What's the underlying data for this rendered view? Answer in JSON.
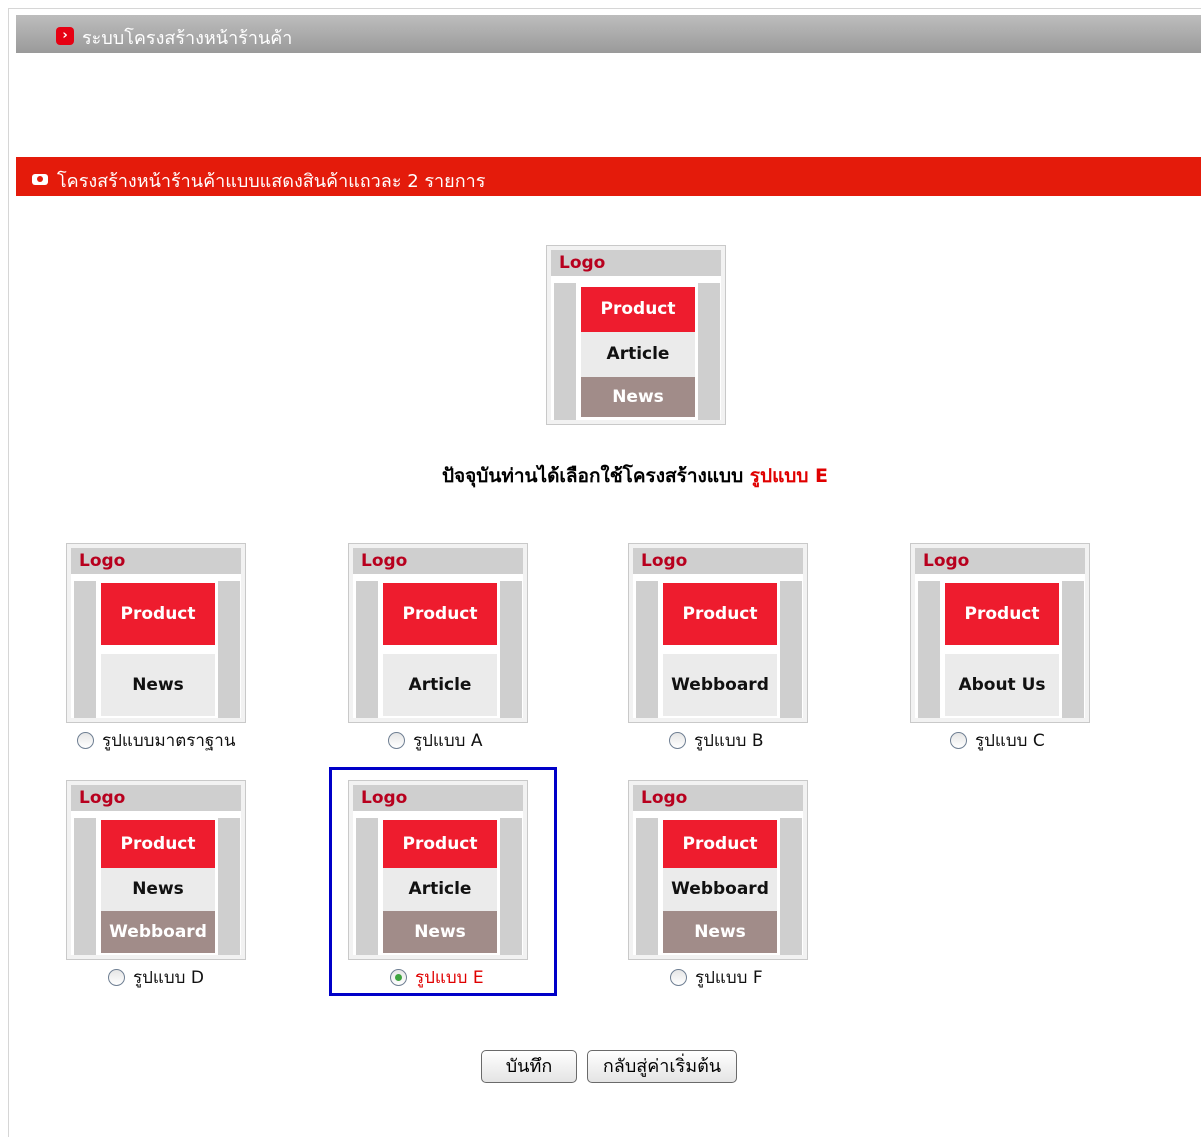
{
  "header": {
    "icon": "chevron-right-icon",
    "title": "ระบบโครงสร้างหน้าร้านค้า"
  },
  "section": {
    "icon": "camera-icon",
    "title": "โครงสร้างหน้าร้านค้าแบบแสดงสินค้าแถวละ 2 รายการ"
  },
  "preview": {
    "logo": "Logo",
    "blocks": [
      "Product",
      "Article",
      "News"
    ]
  },
  "current": {
    "prefix": "ปัจจุบันท่านได้เลือกใช้โครงสร้างแบบ",
    "value": "รูปแบบ E"
  },
  "colors": {
    "accent_red": "#e41b0b",
    "block_red": "#ee1c2e",
    "block_mauve": "#a18c89",
    "selection_blue": "#0000c8"
  },
  "layouts": [
    {
      "label": "รูปแบบมาตราฐาน",
      "logo": "Logo",
      "blocks": [
        "Product",
        "News"
      ],
      "selected": false
    },
    {
      "label": "รูปแบบ A",
      "logo": "Logo",
      "blocks": [
        "Product",
        "Article"
      ],
      "selected": false
    },
    {
      "label": "รูปแบบ B",
      "logo": "Logo",
      "blocks": [
        "Product",
        "Webboard"
      ],
      "selected": false
    },
    {
      "label": "รูปแบบ C",
      "logo": "Logo",
      "blocks": [
        "Product",
        "About Us"
      ],
      "selected": false
    },
    {
      "label": "รูปแบบ D",
      "logo": "Logo",
      "blocks": [
        "Product",
        "News",
        "Webboard"
      ],
      "selected": false
    },
    {
      "label": "รูปแบบ E",
      "logo": "Logo",
      "blocks": [
        "Product",
        "Article",
        "News"
      ],
      "selected": true
    },
    {
      "label": "รูปแบบ F",
      "logo": "Logo",
      "blocks": [
        "Product",
        "Webboard",
        "News"
      ],
      "selected": false
    }
  ],
  "buttons": {
    "save": "บันทึก",
    "reset": "กลับสู่ค่าเริ่มต้น"
  }
}
